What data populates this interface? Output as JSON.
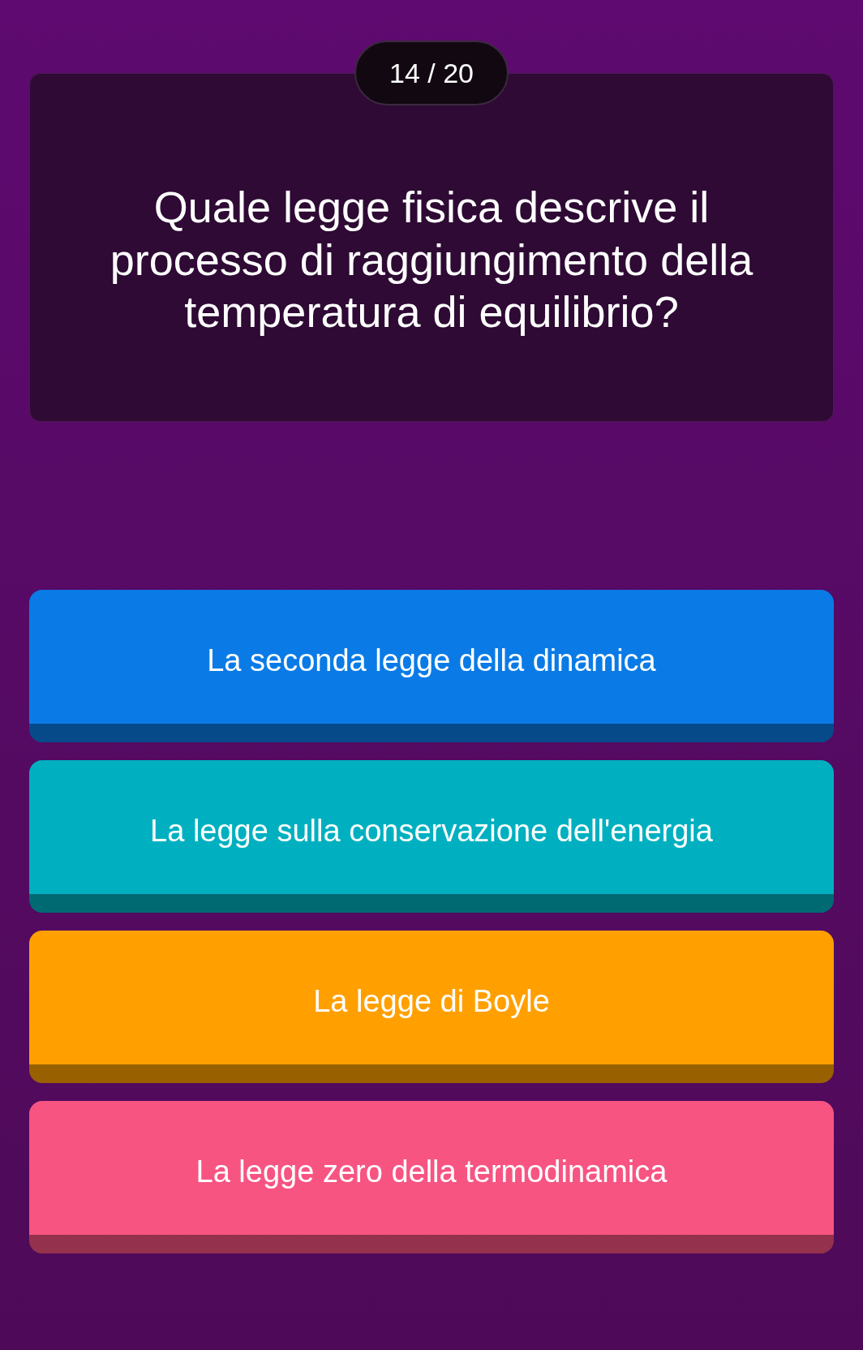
{
  "counter": "14 / 20",
  "question": "Quale legge fisica descrive il processo di raggiungimento della temperatura di equilibrio?",
  "answers": [
    {
      "label": "La seconda legge della dinamica",
      "color": "#0a7be6"
    },
    {
      "label": "La legge sulla conservazione dell'energia",
      "color": "#00b0c0"
    },
    {
      "label": "La legge di Boyle",
      "color": "#ffa000"
    },
    {
      "label": "La legge zero della termodinamica",
      "color": "#f75482"
    }
  ]
}
